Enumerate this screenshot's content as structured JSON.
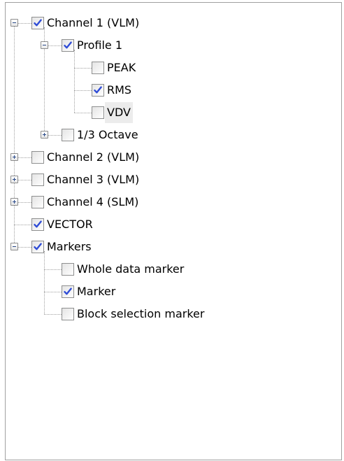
{
  "tree": {
    "nodes": [
      {
        "label": "Channel 1 (VLM)",
        "checked": true,
        "expander": "minus",
        "level": 0
      },
      {
        "label": "Profile 1",
        "checked": true,
        "expander": "minus",
        "level": 1
      },
      {
        "label": "PEAK",
        "checked": false,
        "expander": null,
        "level": 2
      },
      {
        "label": "RMS",
        "checked": true,
        "expander": null,
        "level": 2
      },
      {
        "label": "VDV",
        "checked": false,
        "expander": null,
        "level": 2,
        "highlighted": true
      },
      {
        "label": "1/3 Octave",
        "checked": false,
        "expander": "plus",
        "level": 1
      },
      {
        "label": "Channel 2 (VLM)",
        "checked": false,
        "expander": "plus",
        "level": 0
      },
      {
        "label": "Channel 3 (VLM)",
        "checked": false,
        "expander": "plus",
        "level": 0
      },
      {
        "label": "Channel 4 (SLM)",
        "checked": false,
        "expander": "plus",
        "level": 0
      },
      {
        "label": "VECTOR",
        "checked": true,
        "expander": null,
        "level": 0
      },
      {
        "label": "Markers",
        "checked": true,
        "expander": "minus",
        "level": 0
      },
      {
        "label": "Whole data marker",
        "checked": false,
        "expander": null,
        "level": 1
      },
      {
        "label": "Marker",
        "checked": true,
        "expander": null,
        "level": 1
      },
      {
        "label": "Block selection marker",
        "checked": false,
        "expander": null,
        "level": 1
      }
    ]
  },
  "colors": {
    "check_mark": "#2f4cd6",
    "connector": "#a0a0a0",
    "highlight": "#ececec"
  },
  "icons": {
    "expand": "plus-expander-icon",
    "collapse": "minus-expander-icon",
    "check": "check-mark-icon"
  }
}
